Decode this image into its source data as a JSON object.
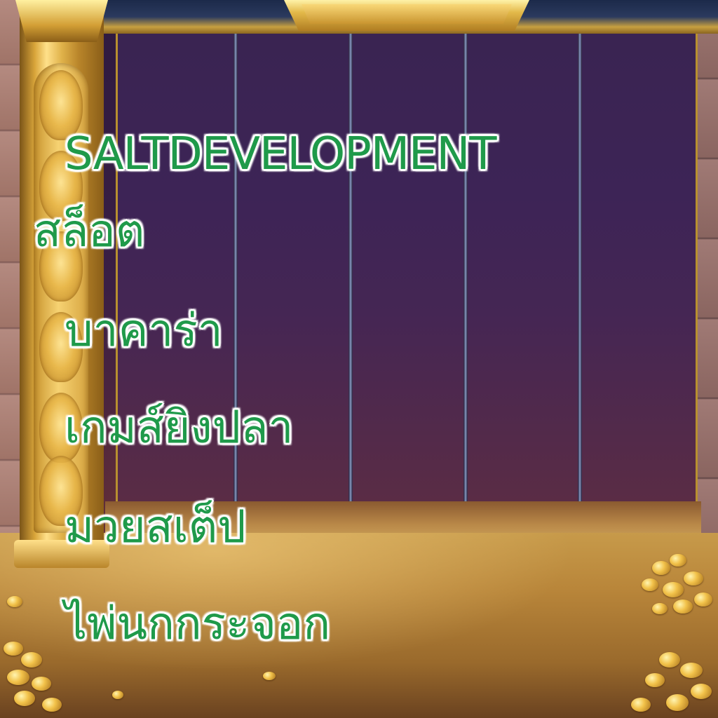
{
  "menu": {
    "items": [
      {
        "label": "SALTDEVELOPMENT"
      },
      {
        "label": "สล็อต"
      },
      {
        "label": "บาคาร่า"
      },
      {
        "label": "เกมส์ยิงปลา"
      },
      {
        "label": "มวยสเต็ป"
      },
      {
        "label": "ไพ่นกกระจอก"
      }
    ]
  },
  "colors": {
    "text": "#1f9a4a",
    "text_outline": "#ffffff",
    "background": "#3a2452",
    "frame_gold": "#e3b94a"
  }
}
